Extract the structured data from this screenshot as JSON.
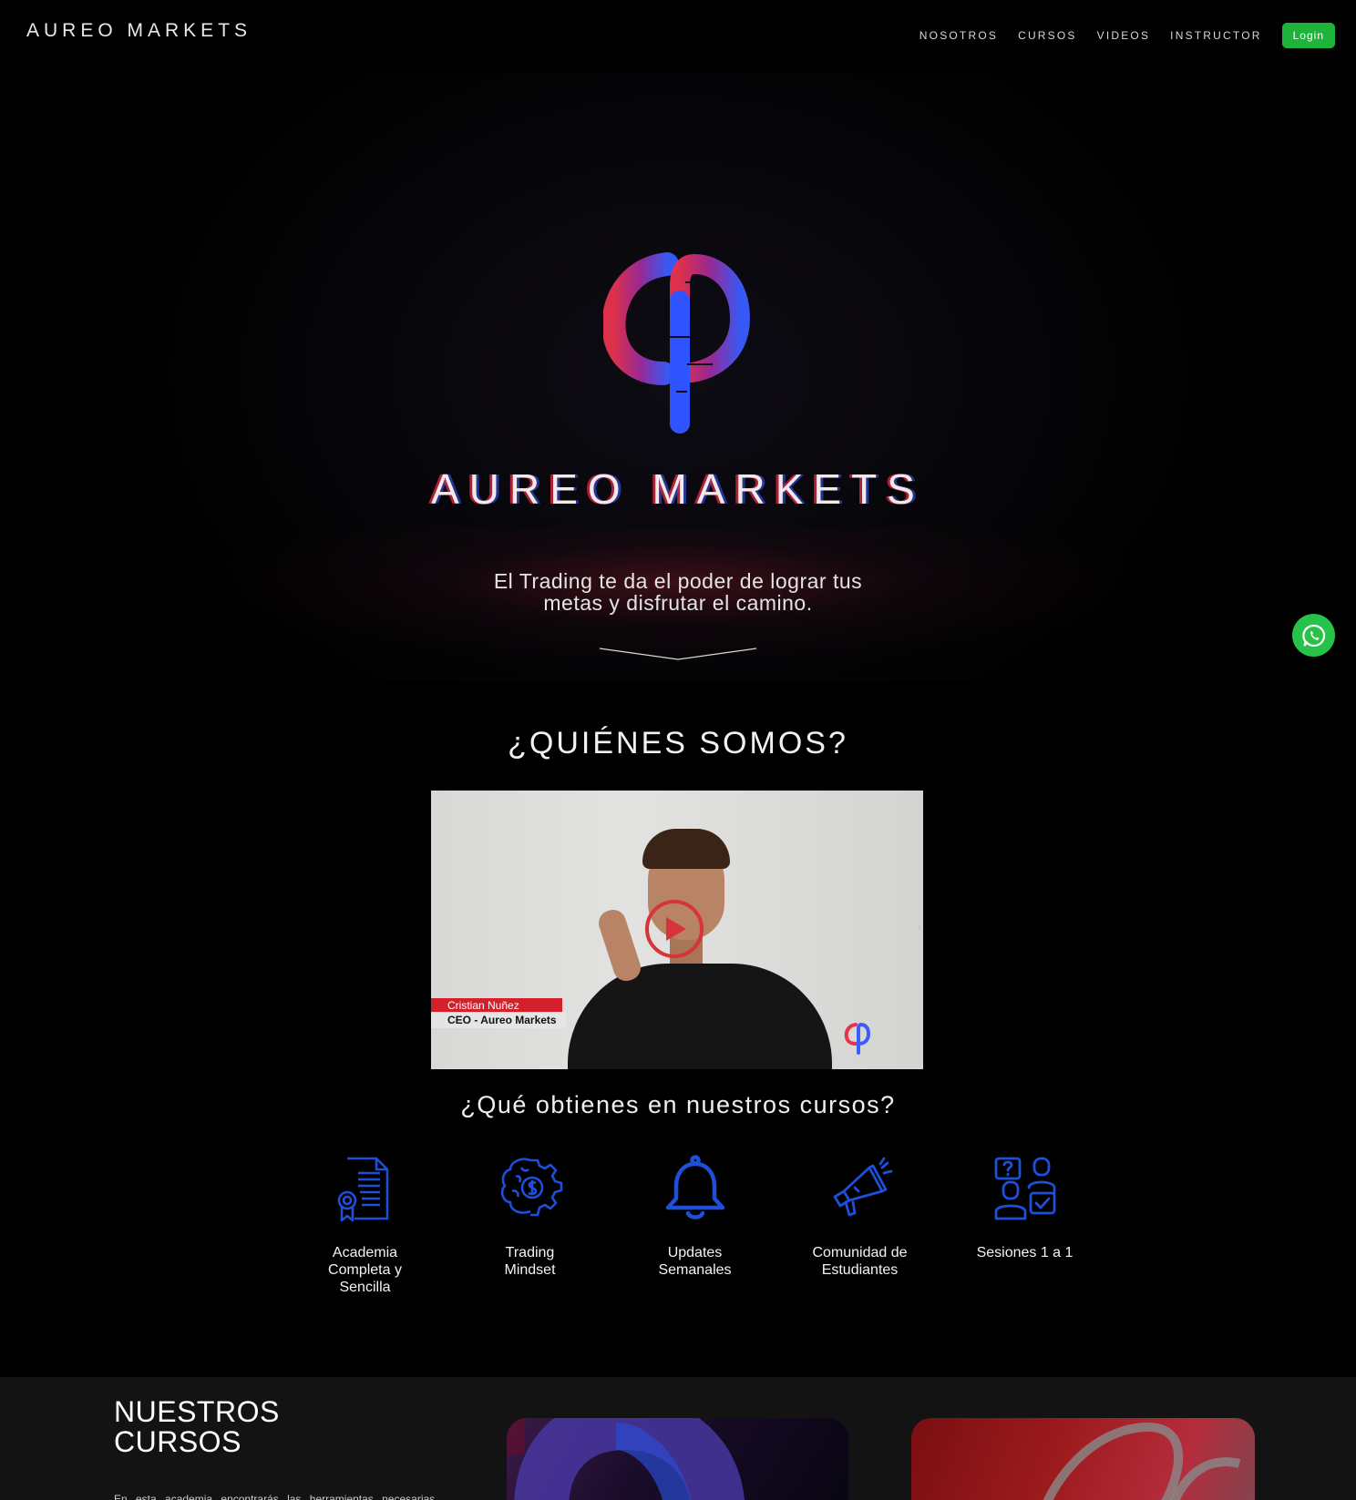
{
  "nav": {
    "brand": "AUREO MARKETS",
    "items": [
      "NOSOTROS",
      "CURSOS",
      "VIDEOS",
      "INSTRUCTOR"
    ],
    "login": "Login"
  },
  "hero": {
    "brand": "AUREO MARKETS",
    "tagline_line1": "El Trading te da el poder de lograr tus",
    "tagline_line2": "metas y disfrutar el camino."
  },
  "who": {
    "title": "¿QUIÉNES SOMOS?",
    "video": {
      "name": "Cristian Nuñez",
      "role": "CEO - Aureo Markets"
    }
  },
  "benefits": {
    "title": "¿Qué obtienes en nuestros cursos?",
    "items": [
      {
        "label": "Academia Completa y Sencilla",
        "icon": "certificate-icon"
      },
      {
        "label": "Trading Mindset",
        "icon": "brain-gear-icon"
      },
      {
        "label": "Updates Semanales",
        "icon": "bell-icon"
      },
      {
        "label": "Comunidad de Estudiantes",
        "icon": "megaphone-icon"
      },
      {
        "label": "Sesiones 1 a 1",
        "icon": "mentoring-icon"
      }
    ]
  },
  "courses": {
    "title_line1": "NUESTROS",
    "title_line2": "CURSOS",
    "description": "En esta academia encontrarás las herramientas necesarias"
  },
  "colors": {
    "accent_green": "#1fb33c",
    "whatsapp": "#27c24a",
    "icon_blue": "#1f4fd8",
    "play_red": "#d6333b"
  }
}
